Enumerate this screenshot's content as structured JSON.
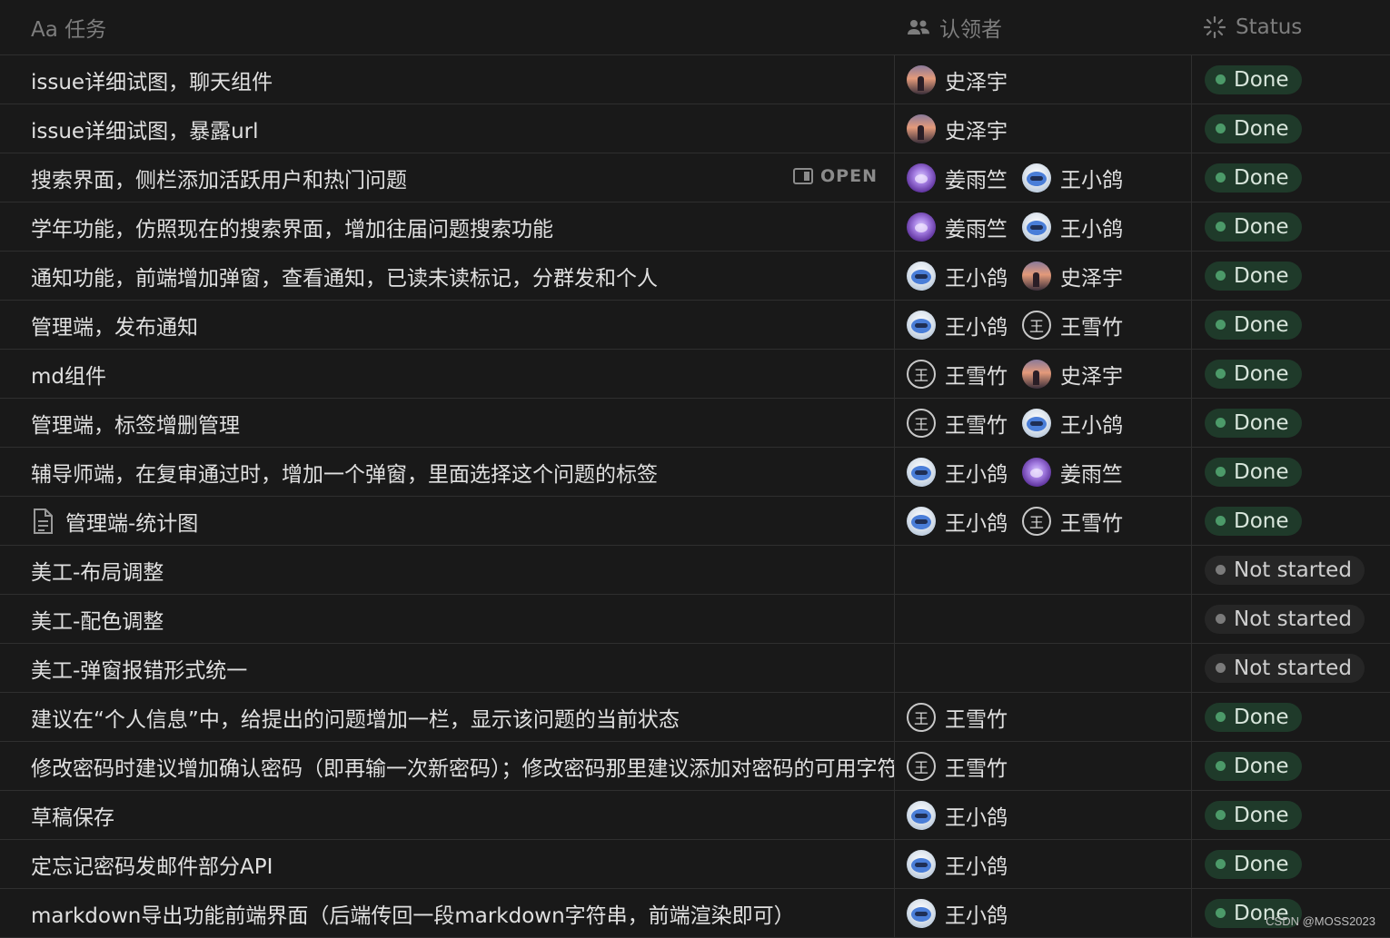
{
  "header": {
    "title_col": "Aa 任务",
    "assignee_col": "认领者",
    "status_col": "Status"
  },
  "open_label": "OPEN",
  "watermark": "CSDN @MOSS2023",
  "rows": [
    {
      "title": "issue详细试图，聊天组件",
      "people": [
        {
          "name": "史泽宇",
          "avatar": "shi"
        }
      ],
      "status": "Done"
    },
    {
      "title": "issue详细试图，暴露url",
      "people": [
        {
          "name": "史泽宇",
          "avatar": "shi"
        }
      ],
      "status": "Done"
    },
    {
      "title": "搜索界面，侧栏添加活跃用户和热门问题",
      "open": true,
      "people": [
        {
          "name": "姜雨竺",
          "avatar": "jiang"
        },
        {
          "name": "王小鸽",
          "avatar": "xiao"
        }
      ],
      "status": "Done"
    },
    {
      "title": "学年功能，仿照现在的搜索界面，增加往届问题搜索功能",
      "people": [
        {
          "name": "姜雨竺",
          "avatar": "jiang"
        },
        {
          "name": "王小鸽",
          "avatar": "xiao"
        }
      ],
      "status": "Done"
    },
    {
      "title": "通知功能，前端增加弹窗，查看通知，已读未读标记，分群发和个人",
      "people": [
        {
          "name": "王小鸽",
          "avatar": "xiao"
        },
        {
          "name": "史泽宇",
          "avatar": "shi"
        }
      ],
      "status": "Done"
    },
    {
      "title": "管理端，发布通知",
      "people": [
        {
          "name": "王小鸽",
          "avatar": "xiao"
        },
        {
          "name": "王雪竹",
          "avatar": "xue"
        }
      ],
      "status": "Done"
    },
    {
      "title": "md组件",
      "people": [
        {
          "name": "王雪竹",
          "avatar": "xue"
        },
        {
          "name": "史泽宇",
          "avatar": "shi"
        }
      ],
      "status": "Done"
    },
    {
      "title": "管理端，标签增删管理",
      "people": [
        {
          "name": "王雪竹",
          "avatar": "xue"
        },
        {
          "name": "王小鸽",
          "avatar": "xiao"
        }
      ],
      "status": "Done"
    },
    {
      "title": "辅导师端，在复审通过时，增加一个弹窗，里面选择这个问题的标签",
      "people": [
        {
          "name": "王小鸽",
          "avatar": "xiao"
        },
        {
          "name": "姜雨竺",
          "avatar": "jiang"
        }
      ],
      "status": "Done"
    },
    {
      "title": "管理端-统计图",
      "doc": true,
      "people": [
        {
          "name": "王小鸽",
          "avatar": "xiao"
        },
        {
          "name": "王雪竹",
          "avatar": "xue"
        }
      ],
      "status": "Done"
    },
    {
      "title": "美工-布局调整",
      "people": [],
      "status": "Not started"
    },
    {
      "title": "美工-配色调整",
      "people": [],
      "status": "Not started"
    },
    {
      "title": "美工-弹窗报错形式统一",
      "people": [],
      "status": "Not started"
    },
    {
      "title": "建议在“个人信息”中，给提出的问题增加一栏，显示该问题的当前状态",
      "people": [
        {
          "name": "王雪竹",
          "avatar": "xue"
        }
      ],
      "status": "Done"
    },
    {
      "title": "修改密码时建议增加确认密码（即再输一次新密码）；修改密码那里建议添加对密码的可用字符",
      "people": [
        {
          "name": "王雪竹",
          "avatar": "xue"
        }
      ],
      "status": "Done"
    },
    {
      "title": "草稿保存",
      "people": [
        {
          "name": "王小鸽",
          "avatar": "xiao"
        }
      ],
      "status": "Done"
    },
    {
      "title": "定忘记密码发邮件部分API",
      "people": [
        {
          "name": "王小鸽",
          "avatar": "xiao"
        }
      ],
      "status": "Done"
    },
    {
      "title": "markdown导出功能前端界面（后端传回一段markdown字符串，前端渲染即可）",
      "people": [
        {
          "name": "王小鸽",
          "avatar": "xiao"
        }
      ],
      "status": "Done"
    }
  ]
}
